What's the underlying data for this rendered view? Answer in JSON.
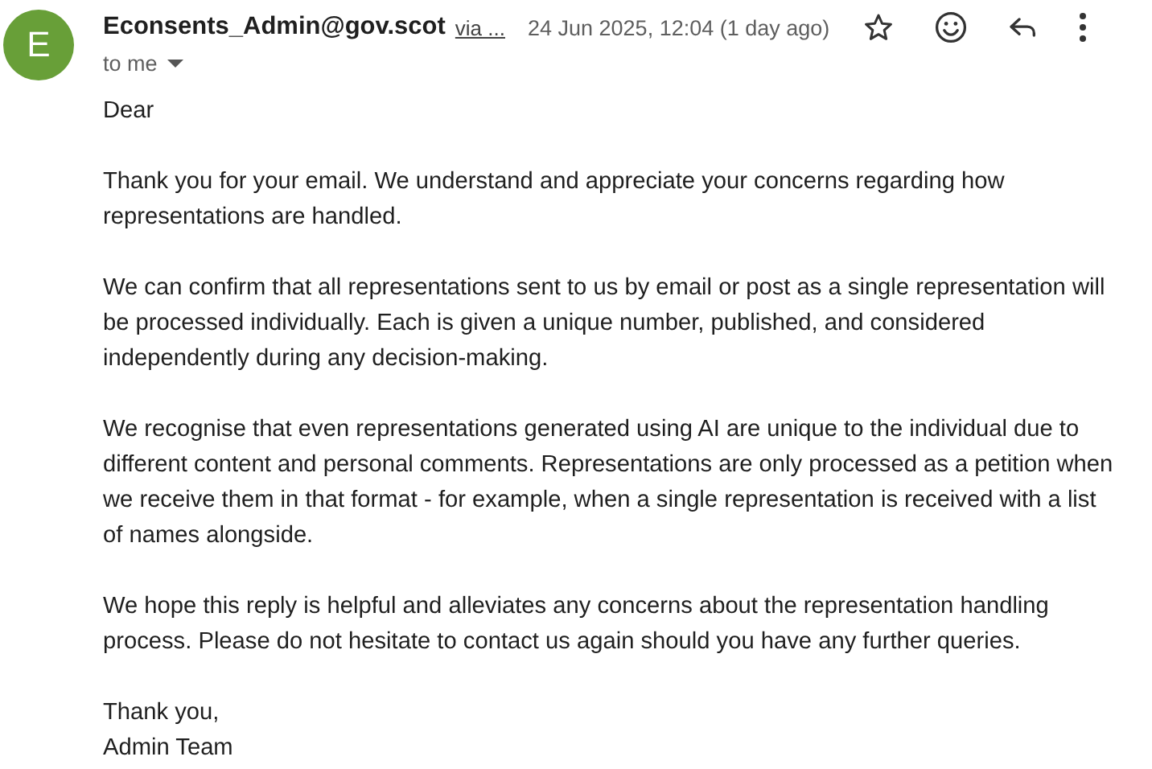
{
  "sender": {
    "initial": "E",
    "name": "Econsents_Admin@gov.scot",
    "via": "via ..."
  },
  "date": "24 Jun 2025, 12:04 (1 day ago)",
  "recipient": "to me",
  "body": [
    [
      "Dear"
    ],
    [
      "Thank you for your email. We understand and appreciate your concerns regarding how",
      "representations are handled."
    ],
    [
      "We can confirm that all representations sent to us by email or post as a single representation will",
      "be processed individually. Each is given a unique number, published, and considered",
      "independently during any decision-making."
    ],
    [
      "We recognise that even representations generated using AI are unique to the individual due to",
      "different content and personal comments. Representations are only processed as a petition when",
      "we receive them in that format - for example, when a single representation is received with a list",
      "of names alongside."
    ],
    [
      "We hope this reply is helpful and alleviates any concerns about the representation handling",
      "process. Please do not hesitate to contact us again should you have any further queries."
    ],
    [
      "Thank you,",
      "Admin Team"
    ]
  ]
}
